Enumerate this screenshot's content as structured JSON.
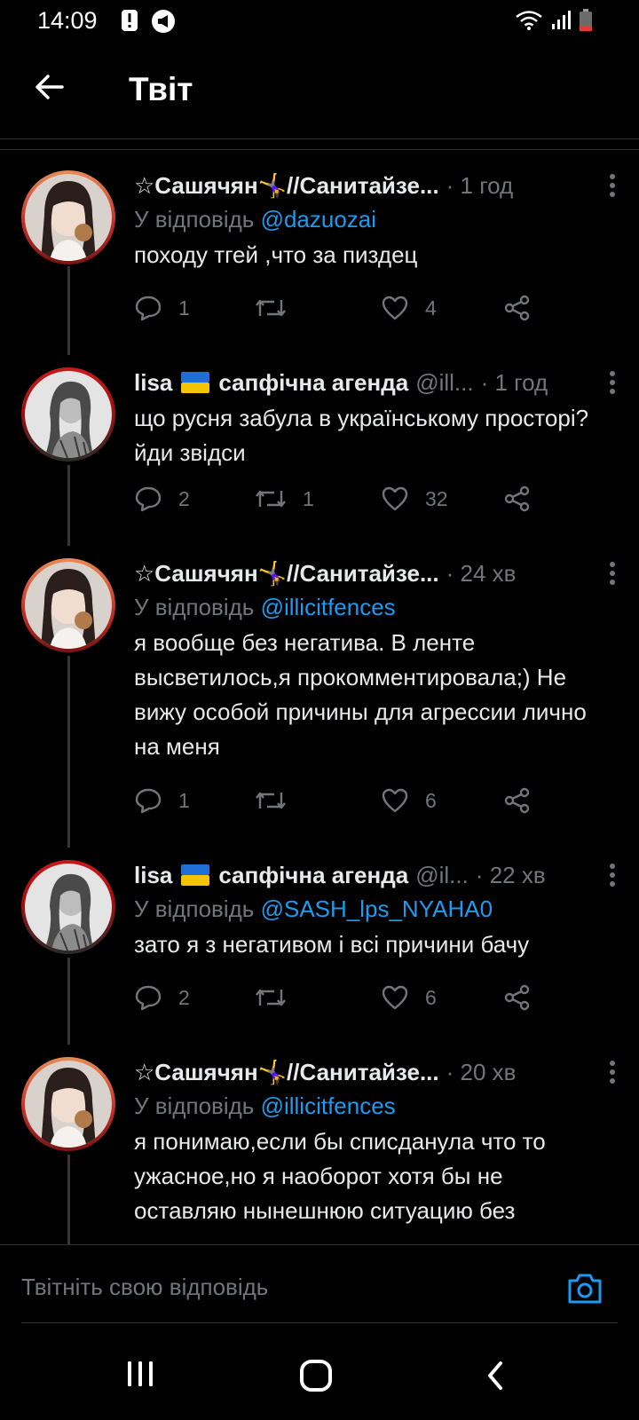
{
  "status_bar": {
    "time": "14:09"
  },
  "header": {
    "title": "Твіт"
  },
  "tweets": [
    {
      "author": "☆Сашячян🤸‍♀️//Санитайзе...",
      "handle": "",
      "time": "· 1 год",
      "reply_prefix": "У відповідь ",
      "reply_to": "@dazuozai",
      "text": "походу тгей ,что за пиздец",
      "replies": "1",
      "retweets": "",
      "likes": "4"
    },
    {
      "author_name": "lisa",
      "author_rest": "сапфічна агенда",
      "handle": "@ill...",
      "time": "· 1 год",
      "text": "що русня забула в українському просторі? йди звідси",
      "replies": "2",
      "retweets": "1",
      "likes": "32"
    },
    {
      "author": "☆Сашячян🤸‍♀️//Санитайзе...",
      "time": "· 24 хв",
      "reply_prefix": "У відповідь ",
      "reply_to": "@illicitfences",
      "text": "я вообще без негатива. В ленте высветилось,я прокомментировала;) Не вижу особой причины для агрессии лично на меня",
      "replies": "1",
      "retweets": "",
      "likes": "6"
    },
    {
      "author_name": "lisa",
      "author_rest": "сапфічна агенда",
      "handle": "@il...",
      "time": "· 22 хв",
      "reply_prefix": "У відповідь ",
      "reply_to": "@SASH_lps_NYAHA0",
      "text": "зато я з негативом і всі причини бачу",
      "replies": "2",
      "retweets": "",
      "likes": "6"
    },
    {
      "author": "☆Сашячян🤸‍♀️//Санитайзе...",
      "time": "· 20 хв",
      "reply_prefix": "У відповідь ",
      "reply_to": "@illicitfences",
      "text": "я понимаю,если бы списданула что то ужасное,но я наоборот хотя бы не оставляю нынешнюю ситуацию без"
    }
  ],
  "composer": {
    "placeholder": "Твітніть свою відповідь"
  },
  "colors": {
    "background": "#000000",
    "text": "#e7e9ea",
    "muted": "#71767b",
    "accent": "#1d9bf0"
  },
  "icons": [
    "arrow-left-icon",
    "reply-icon",
    "retweet-icon",
    "like-icon",
    "share-icon",
    "more-icon",
    "camera-icon",
    "recents-icon",
    "home-icon",
    "back-icon"
  ]
}
